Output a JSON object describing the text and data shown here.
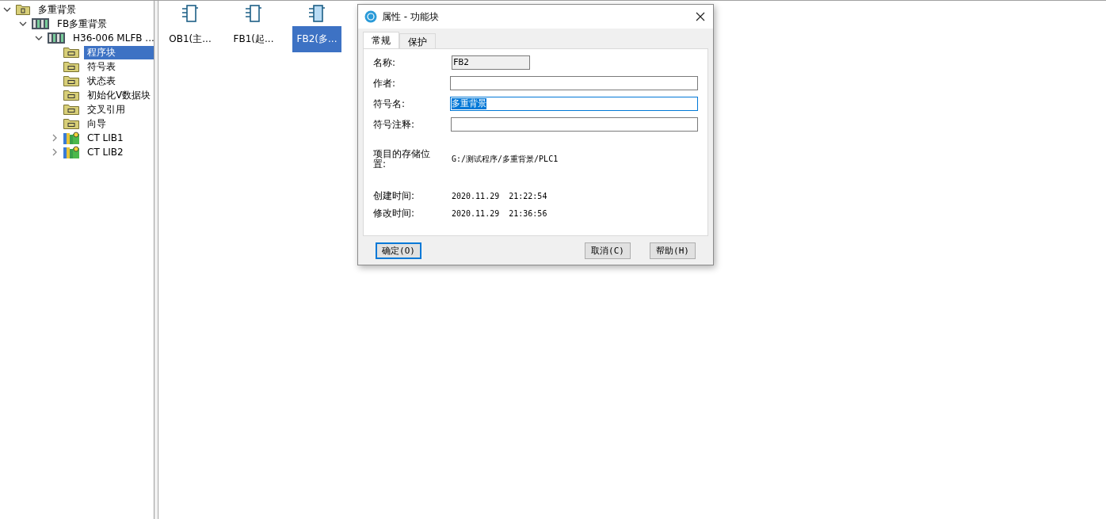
{
  "tree": [
    {
      "label": "多重背景",
      "kind": "project",
      "expanded": true,
      "selected": false,
      "children": [
        {
          "label": "FB多重背景",
          "kind": "plc",
          "expanded": true,
          "selected": false,
          "children": [
            {
              "label": "H36-006 MLFB ...",
              "kind": "plc",
              "expanded": true,
              "selected": false,
              "children": [
                {
                  "label": "程序块",
                  "kind": "folder",
                  "selected": true
                },
                {
                  "label": "符号表",
                  "kind": "folder",
                  "selected": false
                },
                {
                  "label": "状态表",
                  "kind": "folder",
                  "selected": false
                },
                {
                  "label": "初始化V数据块",
                  "kind": "folder",
                  "selected": false
                },
                {
                  "label": "交叉引用",
                  "kind": "folder",
                  "selected": false
                },
                {
                  "label": "向导",
                  "kind": "folder",
                  "selected": false
                },
                {
                  "label": "CT LIB1",
                  "kind": "library",
                  "expanded": false,
                  "selected": false
                },
                {
                  "label": "CT LIB2",
                  "kind": "library",
                  "expanded": false,
                  "selected": false
                }
              ]
            }
          ]
        }
      ]
    }
  ],
  "blocks": [
    {
      "label": "OB1(主...",
      "selected": false
    },
    {
      "label": "FB1(起...",
      "selected": false
    },
    {
      "label": "FB2(多...",
      "selected": true
    }
  ],
  "dialog": {
    "title": "属性 - 功能块",
    "tabs": [
      {
        "label": "常规",
        "selected": true
      },
      {
        "label": "保护",
        "selected": false
      }
    ],
    "fields": [
      {
        "label": "名称:",
        "value": "FB2",
        "disabled": true,
        "focused": false
      },
      {
        "label": "作者:",
        "disabled": false,
        "focused": false
      },
      {
        "label": "符号名:",
        "value": "多重背景",
        "disabled": false,
        "focused": true,
        "text_selected": true
      },
      {
        "label": "符号注释:",
        "disabled": false,
        "focused": false
      }
    ],
    "location": {
      "label": "项目的存储位置:",
      "value": "G:/测试程序/多重背景/PLC1"
    },
    "times": [
      {
        "label": "创建时间:",
        "value": "2020.11.29  21:22:54"
      },
      {
        "label": "修改时间:",
        "value": "2020.11.29  21:36:56"
      }
    ],
    "buttons": [
      {
        "label": "确定(O)",
        "default": true
      },
      {
        "label": "取消(C)",
        "default": false
      },
      {
        "label": "帮助(H)",
        "default": false
      }
    ]
  }
}
